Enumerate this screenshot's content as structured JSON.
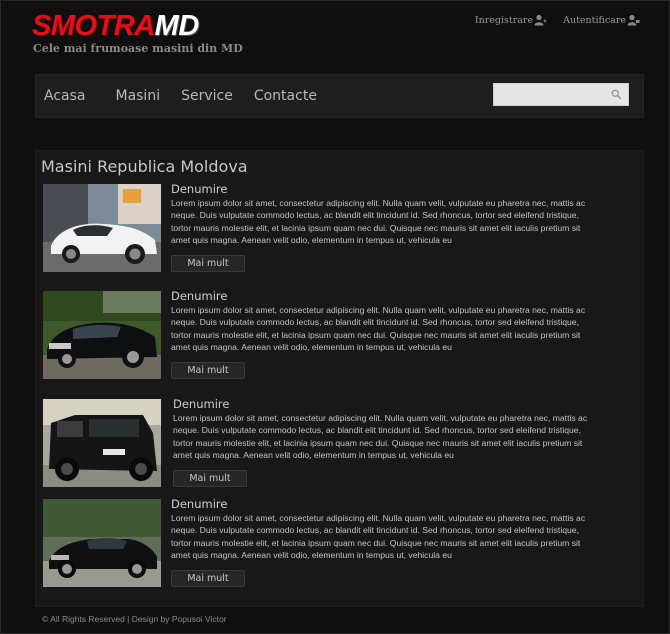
{
  "brand": {
    "logo_part1": "SMOTRA",
    "logo_part2": "MD",
    "tagline": "Cele mai frumoase masini din MD"
  },
  "header": {
    "links": [
      {
        "label": "Inregistrare",
        "icon": "user-add-icon"
      },
      {
        "label": "Autentificare",
        "icon": "user-login-icon"
      }
    ]
  },
  "nav": {
    "items": [
      "Acasa",
      "Masini",
      "Service",
      "Contacte"
    ],
    "search": {
      "value": "",
      "placeholder": "",
      "icon": "search-icon"
    }
  },
  "main": {
    "title": "Masini Republica Moldova",
    "items": [
      {
        "title": "Denumire",
        "text": "Lorem ipsum dolor sit amet, consectetur adipiscing elit. Nulla quam velit, vulputate eu pharetra nec, mattis ac neque. Duis vulputate commodo lectus, ac blandit elit tincidunt id. Sed rhoncus, tortor sed eleifend tristique, tortor mauris molestie elit, et lacinia ipsum quam nec dui. Quisque nec mauris sit amet elit iaculis pretium sit amet quis magna. Aenean velit odio, elementum in tempus ut, vehicula eu",
        "button": "Mai mult",
        "image": "white-sports-car"
      },
      {
        "title": "Denumire",
        "text": "Lorem ipsum dolor sit amet, consectetur adipiscing elit. Nulla quam velit, vulputate eu pharetra nec, mattis ac neque. Duis vulputate commodo lectus, ac blandit elit tincidunt id. Sed rhoncus, tortor sed eleifend tristique, tortor mauris molestie elit, et lacinia ipsum quam nec dui. Quisque nec mauris sit amet elit iaculis pretium sit amet quis magna. Aenean velit odio, elementum in tempus ut, vehicula eu",
        "button": "Mai mult",
        "image": "black-sedan"
      },
      {
        "title": "Denumire",
        "text": "Lorem ipsum dolor sit amet, consectetur adipiscing elit. Nulla quam velit, vulputate eu pharetra nec, mattis ac neque. Duis vulputate commodo lectus, ac blandit elit tincidunt id. Sed rhoncus, tortor sed eleifend tristique, tortor mauris molestie elit, et lacinia ipsum quam nec dui. Quisque nec mauris sit amet elit iaculis pretium sit amet quis magna. Aenean velit odio, elementum in tempus ut, vehicula eu",
        "button": "Mai mult",
        "image": "black-suv"
      },
      {
        "title": "Denumire",
        "text": "Lorem ipsum dolor sit amet, consectetur adipiscing elit. Nulla quam velit, vulputate eu pharetra nec, mattis ac neque. Duis vulputate commodo lectus, ac blandit elit tincidunt id. Sed rhoncus, tortor sed eleifend tristique, tortor mauris molestie elit, et lacinia ipsum quam nec dui. Quisque nec mauris sit amet elit iaculis pretium sit amet quis magna. Aenean velit odio, elementum in tempus ut, vehicula eu",
        "button": "Mai mult",
        "image": "black-luxury-sedan"
      }
    ]
  },
  "footer": {
    "text": "© All Rights Reserved | Design by Popusoi Victor"
  },
  "colors": {
    "accent": "#e0111b",
    "background": "#0f0f0f",
    "panel": "#181818",
    "navbar": "#1e1e1e"
  }
}
